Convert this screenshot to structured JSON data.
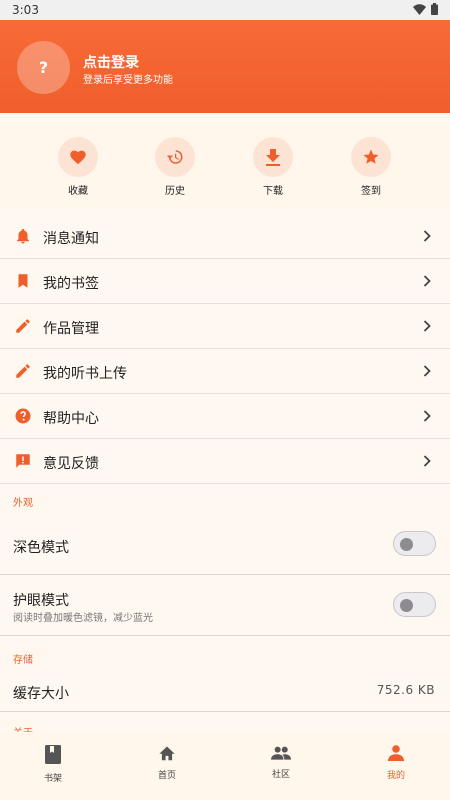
{
  "status_bar": {
    "time": "3:03",
    "wifi_icon": "wifi-icon",
    "battery_icon": "battery-icon"
  },
  "header": {
    "avatar_glyph": "?",
    "title": "点击登录",
    "subtitle": "登录后享受更多功能"
  },
  "quick_actions": [
    {
      "label": "收藏",
      "icon": "heart-icon"
    },
    {
      "label": "历史",
      "icon": "history-icon"
    },
    {
      "label": "下载",
      "icon": "download-icon"
    },
    {
      "label": "签到",
      "icon": "star-icon"
    }
  ],
  "menu": [
    {
      "label": "消息通知",
      "icon": "bell-icon"
    },
    {
      "label": "我的书签",
      "icon": "bookmark-icon"
    },
    {
      "label": "作品管理",
      "icon": "pencil-icon"
    },
    {
      "label": "我的听书上传",
      "icon": "pencil-icon"
    },
    {
      "label": "帮助中心",
      "icon": "help-icon"
    },
    {
      "label": "意见反馈",
      "icon": "feedback-icon"
    }
  ],
  "appearance": {
    "section": "外观",
    "dark_mode": {
      "label": "深色模式",
      "enabled": false
    },
    "eye_care": {
      "label": "护眼模式",
      "description": "阅读时叠加暖色滤镜，减少蓝光",
      "enabled": false
    }
  },
  "storage": {
    "section": "存储",
    "cache_label": "缓存大小",
    "cache_value": "752.6 KB"
  },
  "about": {
    "section": "关于"
  },
  "bottom_nav": [
    {
      "label": "书架",
      "icon": "book-icon",
      "active": false
    },
    {
      "label": "首页",
      "icon": "home-icon",
      "active": false
    },
    {
      "label": "社区",
      "icon": "people-icon",
      "active": false
    },
    {
      "label": "我的",
      "icon": "person-icon",
      "active": true
    }
  ],
  "colors": {
    "accent": "#ef5f2c",
    "header_bg": "#f86a36",
    "page_bg": "#fff8f1",
    "icon_bg": "#fde3d3"
  }
}
